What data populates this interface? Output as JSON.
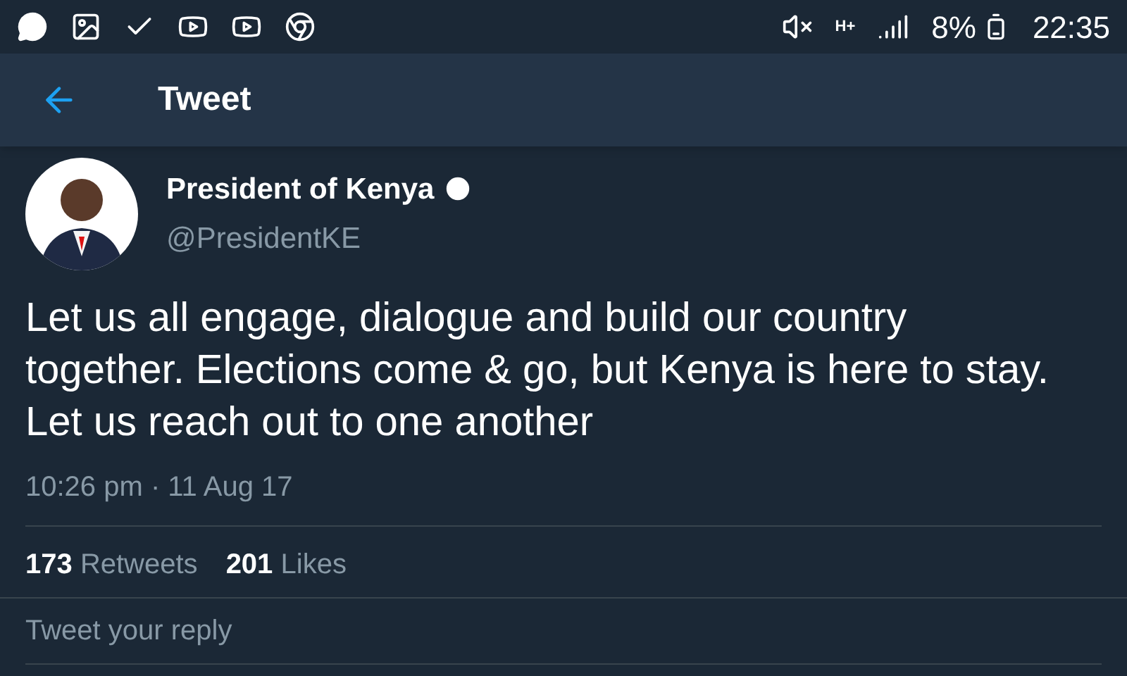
{
  "status_bar": {
    "battery": "8%",
    "time": "22:35",
    "network": "H+"
  },
  "header": {
    "title": "Tweet"
  },
  "tweet": {
    "author": "President of Kenya",
    "verified": true,
    "handle": "@PresidentKE",
    "text": "Let us all engage, dialogue and build our country together. Elections come & go, but Kenya is here to stay. Let us reach out to one another",
    "timestamp": "10:26 pm · 11 Aug 17",
    "stats": [
      {
        "count": "173",
        "label": "Retweets"
      },
      {
        "count": "201",
        "label": "Likes"
      }
    ]
  },
  "reply": {
    "placeholder": "Tweet your reply"
  }
}
